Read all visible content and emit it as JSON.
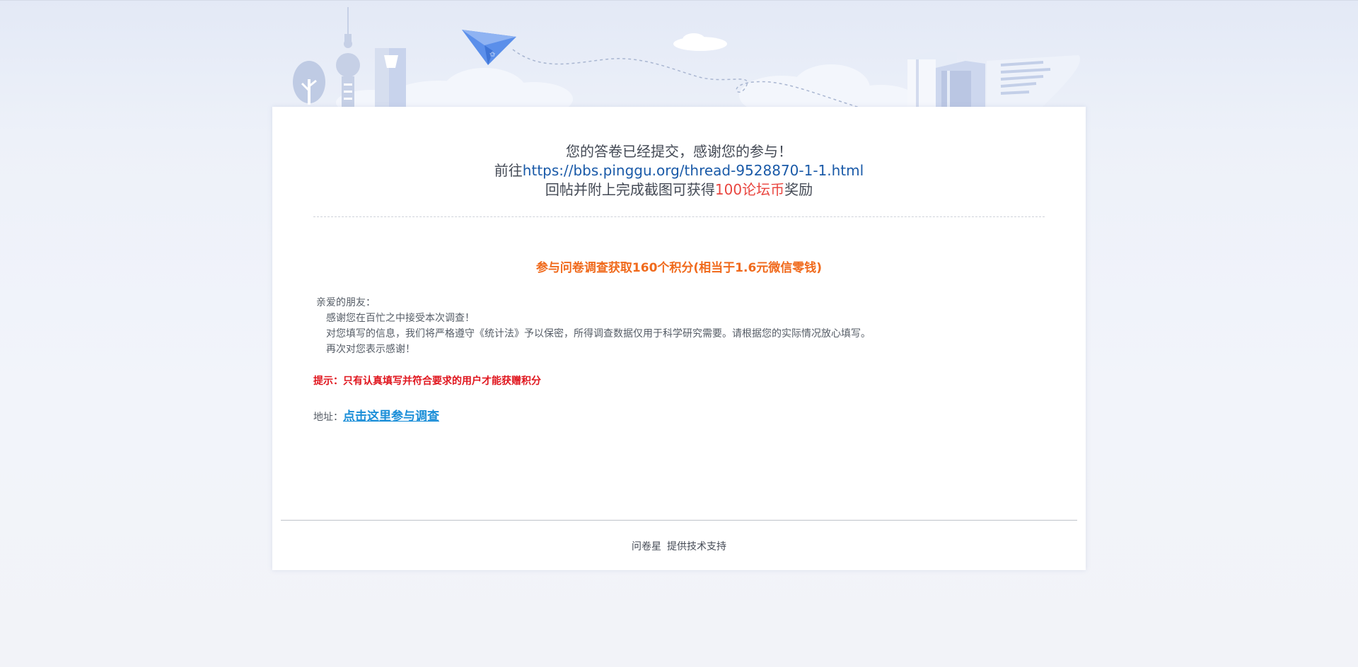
{
  "completion": {
    "line1": "您的答卷已经提交，感谢您的参与！",
    "line2_prefix": "前往",
    "line2_link": "https://bbs.pinggu.org/thread-9528870-1-1.html",
    "line3_prefix": "回帖并附上完成截图可获得",
    "line3_reward": "100论坛币",
    "line3_suffix": "奖励"
  },
  "survey": {
    "title": "参与问卷调查获取160个积分(相当于1.6元微信零钱)",
    "greeting": "亲爱的朋友：",
    "para1": "感谢您在百忙之中接受本次调查！",
    "para2": "对您填写的信息，我们将严格遵守《统计法》予以保密，所得调查数据仅用于科学研究需要。请根据您的实际情况放心填写。",
    "para3": "再次对您表示感谢！",
    "tip": "提示：只有认真填写并符合要求的用户才能获赠积分",
    "address_label": "地址：",
    "address_link": "点击这里参与调查"
  },
  "footer": {
    "brand": "问卷星",
    "support": "提供技术支持"
  },
  "colors": {
    "link": "#1a5aa8",
    "reward": "#e9453f",
    "title_orange": "#f06a1c",
    "tip_red": "#e0161e",
    "survey_link": "#1a8ed8"
  }
}
